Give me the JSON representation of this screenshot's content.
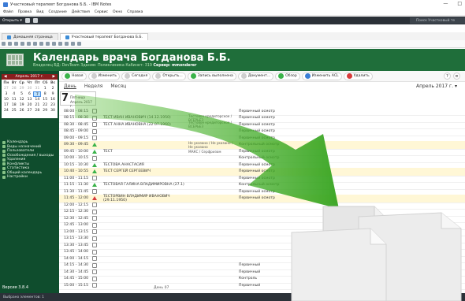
{
  "window": {
    "title": "Участковый терапевт Богданова Б.Б. - IBM Notes",
    "controls": [
      "—",
      "□"
    ]
  },
  "menu": [
    "Файл",
    "Правка",
    "Вид",
    "Создание",
    "Действия",
    "Сервис",
    "Окно",
    "Справка"
  ],
  "darkbar": {
    "open_label": "Открыть ▾",
    "search_placeholder": "Поиск Участковый те"
  },
  "tabs": [
    {
      "label": "Домашняя страница"
    },
    {
      "label": "Участковый терапевт Богданова Б.Б."
    }
  ],
  "header": {
    "title": "Календарь врача Богданова Б.Б.",
    "subtitle_pre": "Владелец БД:",
    "subtitle_owner": "DevTeam",
    "subtitle_mid": "Здание: Поликлиника  Кабинет: 319",
    "subtitle_link": "Сервер: mmonderer"
  },
  "calendar": {
    "month": "Апрель 2017 г.",
    "dow": [
      "Пн",
      "Вт",
      "Ср",
      "Чт",
      "Пт",
      "Сб",
      "Вс"
    ],
    "weeks": [
      [
        "27",
        "28",
        "29",
        "30",
        "31",
        "1",
        "2"
      ],
      [
        "3",
        "4",
        "5",
        "6",
        "7",
        "8",
        "9"
      ],
      [
        "10",
        "11",
        "12",
        "13",
        "14",
        "15",
        "16"
      ],
      [
        "17",
        "18",
        "19",
        "20",
        "21",
        "22",
        "23"
      ],
      [
        "24",
        "25",
        "26",
        "27",
        "28",
        "29",
        "30"
      ]
    ]
  },
  "leftnav": [
    "Календарь",
    "Виды назначений",
    "Пользователи",
    "Освобождения / выходы",
    "Удаления",
    "Конфликты",
    "Статистика",
    "Общий календарь",
    "Настройки"
  ],
  "version": "Версия 3.8.4",
  "actions": [
    "Новая",
    "Изменить",
    "Сегодня",
    "Открыть...",
    "Запись выполнена",
    "Документ...",
    "Обзор",
    "Изменить ACL",
    "Удалить"
  ],
  "views": [
    "День",
    "Неделя",
    "Месяц"
  ],
  "month_label": "Апрель 2017 г. ▾",
  "daycard": {
    "number": "7",
    "line1": "Пятница",
    "line2": "Апрель 2017 г."
  },
  "schedule": [
    {
      "time": "08:00 - 08:15",
      "status_icon": "checkbox",
      "patient": "",
      "ins": "",
      "status": "Первичный осмотр"
    },
    {
      "time": "08:15 - 08:30",
      "status_icon": "checkbox",
      "patient": "ТЕСТ ИВАН ИВАНОВИЧ (14.12.1950)",
      "ins": "Тестовое кредиторское / ВСЕРЬЕЗ",
      "status": "Первичный осмотр"
    },
    {
      "time": "08:30 - 08:45",
      "status_icon": "checkbox",
      "patient": "ТЕСТ АННА ИВАНОВНА (22.07.1960)",
      "ins": "Тестовое кредиторское / ВСЕРЬЕЗ",
      "status": "Первичный осмотр"
    },
    {
      "time": "08:45 - 09:00",
      "status_icon": "checkbox",
      "patient": "",
      "ins": "",
      "status": "Первичный осмотр"
    },
    {
      "time": "09:00 - 09:15",
      "status_icon": "checkbox",
      "patient": "",
      "ins": "",
      "status": "Первичный осмотр"
    },
    {
      "time": "09:30 - 09:45",
      "status_icon": "triangle-green",
      "patient": "",
      "ins": "Не указано / Не указано / Не указано",
      "status": "Контрольный осмотр",
      "hl": true
    },
    {
      "time": "09:45 - 10:00",
      "status_icon": "triangle-green",
      "patient": "ТЕСТ",
      "ins": "МАКС / Серфризом",
      "status": "Первичный осмотр"
    },
    {
      "time": "10:00 - 10:15",
      "status_icon": "checkbox",
      "patient": "",
      "ins": "",
      "status": "Контрольный осмотр"
    },
    {
      "time": "10:15 - 10:30",
      "status_icon": "triangle-green",
      "patient": "ТЕСТОВА АНАСТАСИЯ",
      "ins": "",
      "status": "Первичный осмотр"
    },
    {
      "time": "10:40 - 10:55",
      "status_icon": "triangle-green",
      "patient": "ТЕСТ СЕРГЕЙ СЕРГЕЕВИЧ",
      "ins": "",
      "status": "Первичный осмотр",
      "hl": true
    },
    {
      "time": "11:00 - 11:15",
      "status_icon": "checkbox",
      "patient": "",
      "ins": "",
      "status": "Первичный осмотр"
    },
    {
      "time": "11:15 - 11:30",
      "status_icon": "triangle-green",
      "patient": "ТЕСТОВАЯ ГАЛИНА ВЛАДИМИРОВНА (27.1)",
      "ins": "",
      "status": "Контрольный осмотр"
    },
    {
      "time": "11:30 - 11:45",
      "status_icon": "checkbox",
      "patient": "",
      "ins": "",
      "status": "Первичный осмотр"
    },
    {
      "time": "11:45 - 12:00",
      "status_icon": "triangle-red",
      "patient": "ТЕСТОРВИН ВЛАДИМИР ИВАНОВИЧ (29.11.1950)",
      "ins": "",
      "status": "Первичный осмотр",
      "hl": true
    },
    {
      "time": "12:00 - 12:15",
      "status_icon": "checkbox",
      "patient": "",
      "ins": "",
      "status": ""
    },
    {
      "time": "12:15 - 12:30",
      "status_icon": "checkbox",
      "patient": "",
      "ins": "",
      "status": ""
    },
    {
      "time": "12:30 - 12:45",
      "status_icon": "checkbox",
      "patient": "",
      "ins": "",
      "status": ""
    },
    {
      "time": "12:45 - 13:00",
      "status_icon": "checkbox",
      "patient": "",
      "ins": "",
      "status": ""
    },
    {
      "time": "13:00 - 13:15",
      "status_icon": "checkbox",
      "patient": "",
      "ins": "",
      "status": ""
    },
    {
      "time": "13:15 - 13:30",
      "status_icon": "checkbox",
      "patient": "",
      "ins": "",
      "status": ""
    },
    {
      "time": "13:30 - 13:45",
      "status_icon": "checkbox",
      "patient": "",
      "ins": "",
      "status": ""
    },
    {
      "time": "13:45 - 14:00",
      "status_icon": "checkbox",
      "patient": "",
      "ins": "",
      "status": ""
    },
    {
      "time": "14:00 - 14:15",
      "status_icon": "checkbox",
      "patient": "",
      "ins": "",
      "status": ""
    },
    {
      "time": "14:15 - 14:30",
      "status_icon": "checkbox",
      "patient": "",
      "ins": "",
      "status": "Первичный"
    },
    {
      "time": "14:30 - 14:45",
      "status_icon": "checkbox",
      "patient": "",
      "ins": "",
      "status": "Первичный"
    },
    {
      "time": "14:45 - 15:00",
      "status_icon": "checkbox",
      "patient": "",
      "ins": "",
      "status": "Контроль"
    },
    {
      "time": "15:00 - 15:15",
      "status_icon": "checkbox",
      "patient": "",
      "ins": "",
      "status": "Первичный"
    }
  ],
  "day_label": "День 07",
  "statusbar": "Выбрано элементов: 1"
}
